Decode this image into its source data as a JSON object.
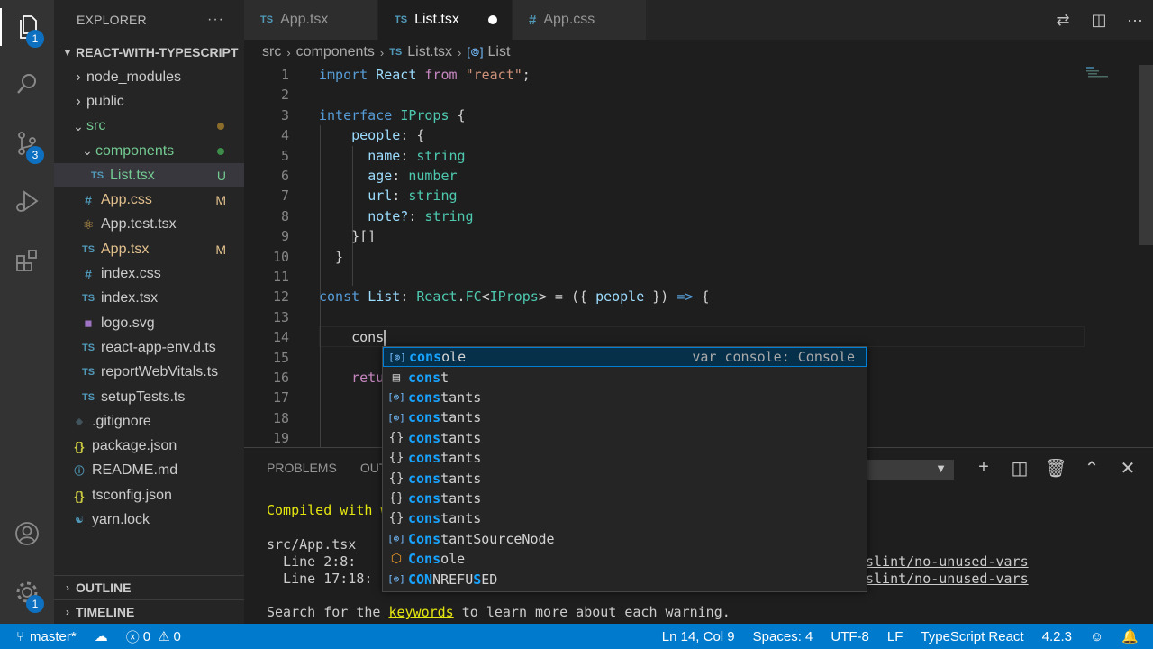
{
  "activity": {
    "explorer_badge": "1",
    "scm_badge": "3",
    "settings_badge": "1"
  },
  "sidebar": {
    "title": "EXPLORER",
    "more": "···",
    "project": "REACT-WITH-TYPESCRIPT",
    "tree": [
      {
        "label": "node_modules",
        "indent": 1,
        "type": "folder",
        "open": false,
        "color": "#cccccc"
      },
      {
        "label": "public",
        "indent": 1,
        "type": "folder",
        "open": false,
        "color": "#cccccc"
      },
      {
        "label": "src",
        "indent": 1,
        "type": "folder",
        "open": true,
        "color": "#73c991",
        "dot": "#8a6d2a"
      },
      {
        "label": "components",
        "indent": 2,
        "type": "folder",
        "open": true,
        "color": "#73c991",
        "dot": "#3d8c4a"
      },
      {
        "label": "List.tsx",
        "indent": 3,
        "type": "ts",
        "color": "#73c991",
        "status": "U",
        "selected": true
      },
      {
        "label": "App.css",
        "indent": 2,
        "type": "css",
        "color": "#e2c08d",
        "status": "M"
      },
      {
        "label": "App.test.tsx",
        "indent": 2,
        "type": "react",
        "color": "#cccccc"
      },
      {
        "label": "App.tsx",
        "indent": 2,
        "type": "ts",
        "color": "#e2c08d",
        "status": "M"
      },
      {
        "label": "index.css",
        "indent": 2,
        "type": "css",
        "color": "#cccccc"
      },
      {
        "label": "index.tsx",
        "indent": 2,
        "type": "ts",
        "color": "#cccccc"
      },
      {
        "label": "logo.svg",
        "indent": 2,
        "type": "svg",
        "color": "#cccccc"
      },
      {
        "label": "react-app-env.d.ts",
        "indent": 2,
        "type": "ts",
        "color": "#cccccc"
      },
      {
        "label": "reportWebVitals.ts",
        "indent": 2,
        "type": "ts",
        "color": "#cccccc"
      },
      {
        "label": "setupTests.ts",
        "indent": 2,
        "type": "ts",
        "color": "#cccccc"
      },
      {
        "label": ".gitignore",
        "indent": 1,
        "type": "git",
        "color": "#cccccc"
      },
      {
        "label": "package.json",
        "indent": 1,
        "type": "json",
        "color": "#cccccc"
      },
      {
        "label": "README.md",
        "indent": 1,
        "type": "info",
        "color": "#cccccc"
      },
      {
        "label": "tsconfig.json",
        "indent": 1,
        "type": "json",
        "color": "#cccccc"
      },
      {
        "label": "yarn.lock",
        "indent": 1,
        "type": "yarn",
        "color": "#cccccc"
      }
    ],
    "outline": "OUTLINE",
    "timeline": "TIMELINE"
  },
  "tabs": [
    {
      "label": "App.tsx",
      "type": "ts",
      "active": false
    },
    {
      "label": "List.tsx",
      "type": "ts",
      "active": true,
      "modified": true
    },
    {
      "label": "App.css",
      "type": "css",
      "active": false
    }
  ],
  "breadcrumb": {
    "seg1": "src",
    "seg2": "components",
    "seg3_icon": "TS",
    "seg3": "List.tsx",
    "seg4": "List"
  },
  "editor": {
    "lines": [
      {
        "n": "1",
        "tokens": [
          [
            "k",
            "import"
          ],
          [
            "p",
            " "
          ],
          [
            "v",
            "React"
          ],
          [
            "p",
            " "
          ],
          [
            "kc",
            "from"
          ],
          [
            "p",
            " "
          ],
          [
            "s",
            "\"react\""
          ],
          [
            "p",
            ";"
          ]
        ]
      },
      {
        "n": "2",
        "tokens": []
      },
      {
        "n": "3",
        "tokens": [
          [
            "k",
            "interface"
          ],
          [
            "p",
            " "
          ],
          [
            "t",
            "IProps"
          ],
          [
            "p",
            " {"
          ]
        ]
      },
      {
        "n": "4",
        "tokens": [
          [
            "p",
            "    "
          ],
          [
            "v",
            "people"
          ],
          [
            "p",
            ": {"
          ]
        ]
      },
      {
        "n": "5",
        "tokens": [
          [
            "p",
            "      "
          ],
          [
            "v",
            "name"
          ],
          [
            "p",
            ": "
          ],
          [
            "t",
            "string"
          ]
        ]
      },
      {
        "n": "6",
        "tokens": [
          [
            "p",
            "      "
          ],
          [
            "v",
            "age"
          ],
          [
            "p",
            ": "
          ],
          [
            "t",
            "number"
          ]
        ]
      },
      {
        "n": "7",
        "tokens": [
          [
            "p",
            "      "
          ],
          [
            "v",
            "url"
          ],
          [
            "p",
            ": "
          ],
          [
            "t",
            "string"
          ]
        ]
      },
      {
        "n": "8",
        "tokens": [
          [
            "p",
            "      "
          ],
          [
            "v",
            "note?"
          ],
          [
            "p",
            ": "
          ],
          [
            "t",
            "string"
          ]
        ]
      },
      {
        "n": "9",
        "tokens": [
          [
            "p",
            "    }[]"
          ]
        ]
      },
      {
        "n": "10",
        "tokens": [
          [
            "p",
            "  }"
          ]
        ]
      },
      {
        "n": "11",
        "tokens": []
      },
      {
        "n": "12",
        "tokens": [
          [
            "k",
            "const"
          ],
          [
            "p",
            " "
          ],
          [
            "v",
            "List"
          ],
          [
            "p",
            ": "
          ],
          [
            "t",
            "React"
          ],
          [
            "p",
            "."
          ],
          [
            "t",
            "FC"
          ],
          [
            "p",
            "<"
          ],
          [
            "t",
            "IProps"
          ],
          [
            "p",
            "> = ({ "
          ],
          [
            "v",
            "people"
          ],
          [
            "p",
            " }) "
          ],
          [
            "k",
            "=>"
          ],
          [
            "p",
            " {"
          ]
        ]
      },
      {
        "n": "13",
        "tokens": []
      },
      {
        "n": "14",
        "tokens": [
          [
            "p",
            "    cons"
          ]
        ],
        "caret": true
      },
      {
        "n": "15",
        "tokens": []
      },
      {
        "n": "16",
        "tokens": [
          [
            "p",
            "    "
          ],
          [
            "kc",
            "retu"
          ]
        ]
      },
      {
        "n": "17",
        "tokens": []
      },
      {
        "n": "18",
        "tokens": []
      },
      {
        "n": "19",
        "tokens": []
      }
    ]
  },
  "suggest": [
    {
      "icon": "var",
      "match": "cons",
      "rest": "ole",
      "detail": "var console: Console",
      "focused": true
    },
    {
      "icon": "kwd",
      "match": "cons",
      "rest": "t"
    },
    {
      "icon": "var",
      "match": "cons",
      "rest": "tants"
    },
    {
      "icon": "var",
      "match": "cons",
      "rest": "tants"
    },
    {
      "icon": "ns",
      "match": "cons",
      "rest": "tants"
    },
    {
      "icon": "ns",
      "match": "cons",
      "rest": "tants"
    },
    {
      "icon": "ns",
      "match": "cons",
      "rest": "tants"
    },
    {
      "icon": "ns",
      "match": "cons",
      "rest": "tants"
    },
    {
      "icon": "ns",
      "match": "cons",
      "rest": "tants"
    },
    {
      "icon": "var",
      "match": "Cons",
      "rest": "tantSourceNode"
    },
    {
      "icon": "cls",
      "match": "Cons",
      "rest": "ole"
    },
    {
      "icon": "var",
      "parts": [
        [
          "hl",
          "CON"
        ],
        [
          "",
          "NREFU"
        ],
        [
          "hl",
          "S"
        ],
        [
          "",
          "ED"
        ]
      ]
    }
  ],
  "panel": {
    "tab_problems": "PROBLEMS",
    "tab_output": "OUTPUT",
    "line1_prefix": "Compiled with w",
    "line2": "src/App.tsx",
    "line3_label": "  Line 2:8:",
    "line3_rule": "slint/no-unused-vars",
    "line4_label": "  Line 17:18:",
    "line4_rule": "slint/no-unused-vars",
    "line5_pre": "Search for the ",
    "line5_kw": "keywords",
    "line5_post": " to learn more about each warning."
  },
  "status": {
    "branch": "master*",
    "errors": "0",
    "warnings": "0",
    "position": "Ln 14, Col 9",
    "spaces": "Spaces: 4",
    "encoding": "UTF-8",
    "eol": "LF",
    "language": "TypeScript React",
    "version": "4.2.3"
  }
}
